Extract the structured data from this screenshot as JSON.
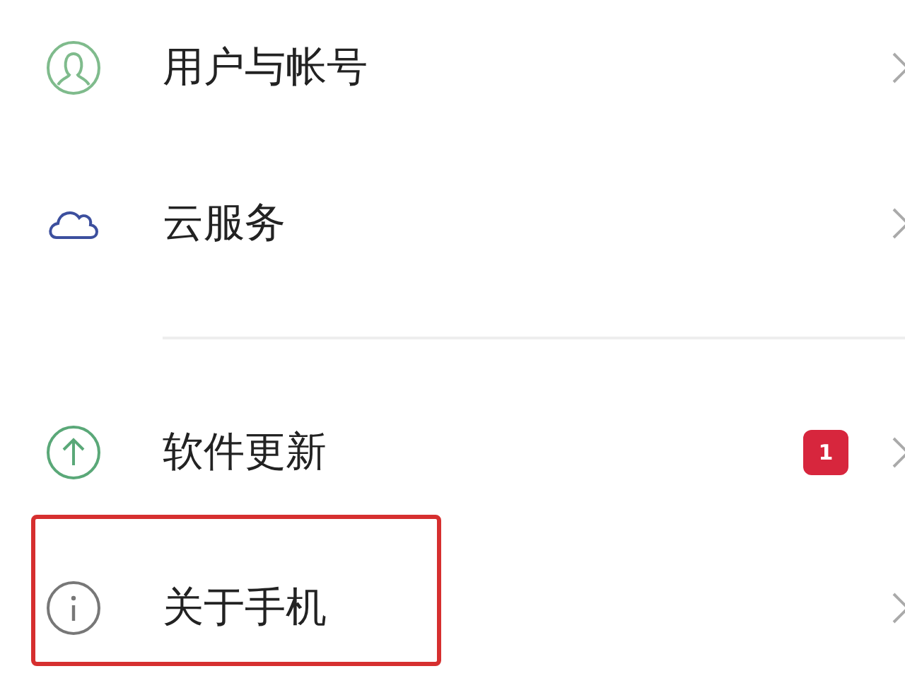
{
  "sections": [
    {
      "items": [
        {
          "label": "用户与帐号",
          "highlighted": false
        },
        {
          "label": "云服务",
          "highlighted": false
        }
      ]
    },
    {
      "items": [
        {
          "label": "软件更新",
          "badge": "1",
          "highlighted": false
        },
        {
          "label": "关于手机",
          "highlighted": true
        }
      ]
    }
  ]
}
